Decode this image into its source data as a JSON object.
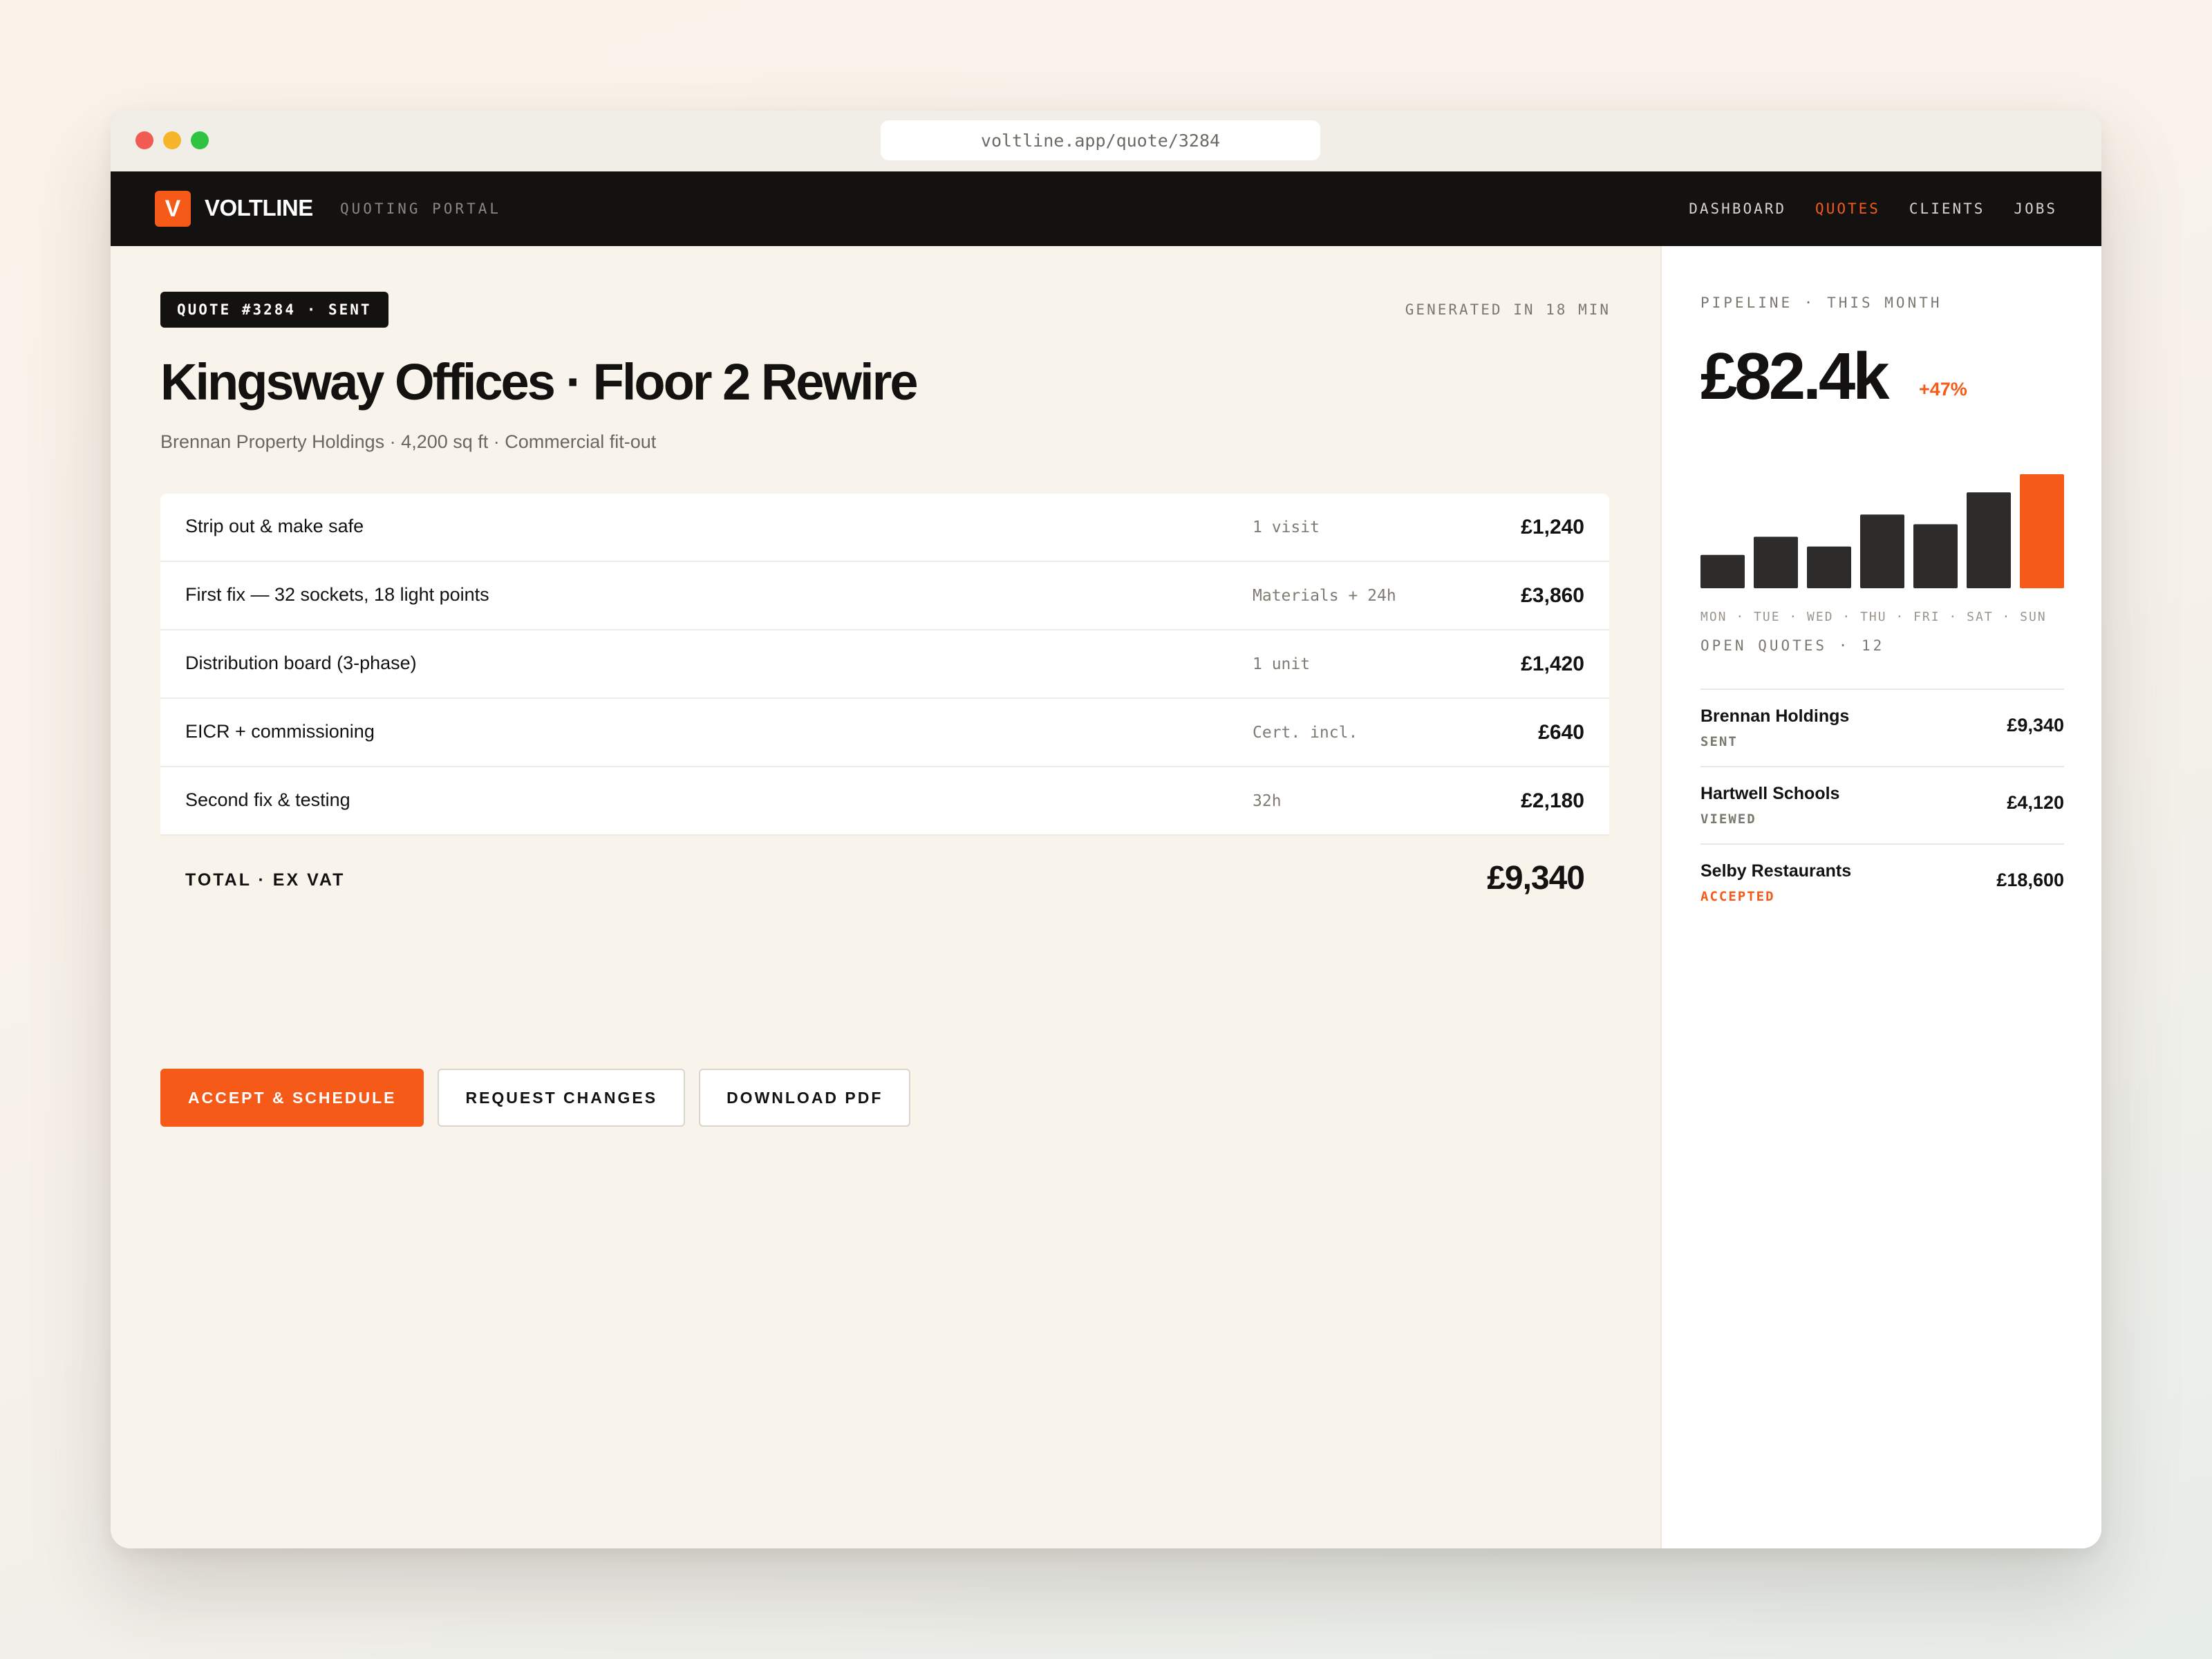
{
  "browser": {
    "url": "voltline.app/quote/3284"
  },
  "topbar": {
    "logo_letter": "V",
    "brand": "VOLTLINE",
    "portal": "QUOTING PORTAL",
    "nav": [
      "DASHBOARD",
      "QUOTES",
      "CLIENTS",
      "JOBS"
    ],
    "active_nav": "QUOTES"
  },
  "quote": {
    "badge": "QUOTE #3284 · SENT",
    "generated": "GENERATED IN 18 MIN",
    "title": "Kingsway Offices · Floor 2 Rewire",
    "subtitle": "Brennan Property Holdings · 4,200 sq ft · Commercial fit-out",
    "lines": [
      {
        "desc": "Strip out & make safe",
        "note": "1 visit",
        "amount": "£1,240"
      },
      {
        "desc": "First fix — 32 sockets, 18 light points",
        "note": "Materials + 24h",
        "amount": "£3,860"
      },
      {
        "desc": "Distribution board (3-phase)",
        "note": "1 unit",
        "amount": "£1,420"
      },
      {
        "desc": "EICR + commissioning",
        "note": "Cert. incl.",
        "amount": "£640"
      },
      {
        "desc": "Second fix & testing",
        "note": "32h",
        "amount": "£2,180"
      }
    ],
    "total_label": "TOTAL · EX VAT",
    "total": "£9,340"
  },
  "actions": {
    "accept": "ACCEPT & SCHEDULE",
    "request": "REQUEST CHANGES",
    "download": "DOWNLOAD PDF"
  },
  "sidebar": {
    "pipeline_label": "PIPELINE · THIS MONTH",
    "pipeline_value": "£82.4k",
    "pipeline_delta": "+47%",
    "chart_days_label": "MON · TUE · WED · THU · FRI · SAT · SUN",
    "open_quotes_label": "OPEN QUOTES · 12",
    "open_quotes": [
      {
        "name": "Brennan Holdings",
        "status": "SENT",
        "amount": "£9,340"
      },
      {
        "name": "Hartwell Schools",
        "status": "VIEWED",
        "amount": "£4,120"
      },
      {
        "name": "Selby Restaurants",
        "status": "ACCEPTED",
        "amount": "£18,600"
      }
    ]
  },
  "colors": {
    "accent": "#f65a18",
    "dark": "#131210",
    "bar": "#2e2c2a"
  },
  "chart_data": {
    "type": "bar",
    "categories": [
      "MON",
      "TUE",
      "WED",
      "THU",
      "FRI",
      "SAT",
      "SUN"
    ],
    "values": [
      24,
      37,
      30,
      53,
      46,
      69,
      82
    ],
    "highlight_index": 6,
    "ylim": [
      0,
      82
    ],
    "grid": false
  }
}
